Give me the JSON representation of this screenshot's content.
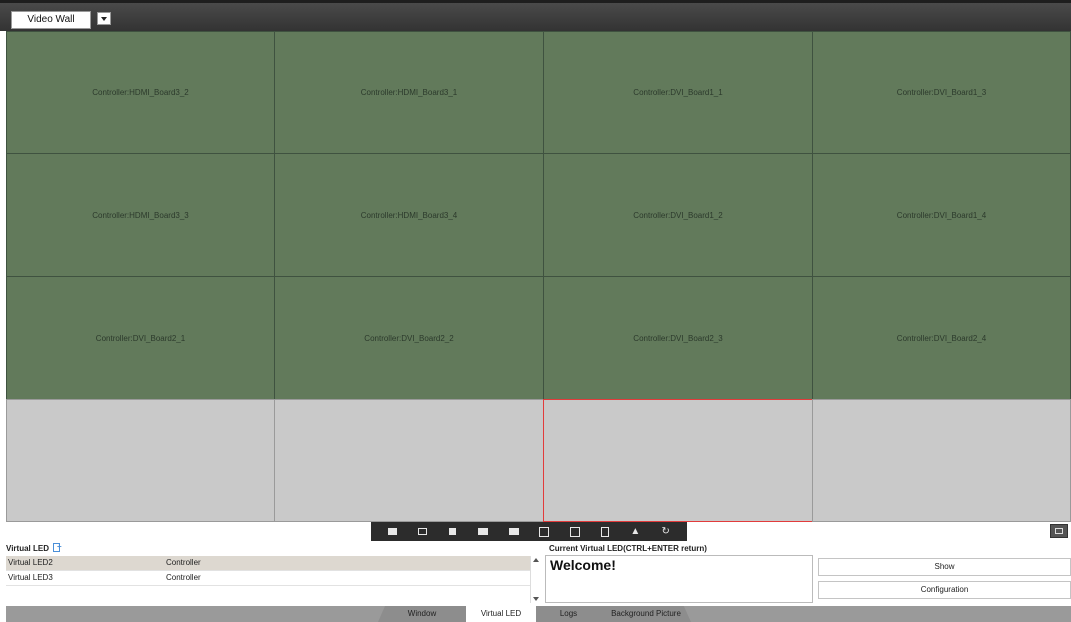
{
  "topbar": {
    "wall_name": "Video Wall"
  },
  "grid": {
    "rows": [
      [
        "Controller:HDMI_Board3_2",
        "Controller:HDMI_Board3_1",
        "Controller:DVI_Board1_1",
        "Controller:DVI_Board1_3"
      ],
      [
        "Controller:HDMI_Board3_3",
        "Controller:HDMI_Board3_4",
        "Controller:DVI_Board1_2",
        "Controller:DVI_Board1_4"
      ],
      [
        "Controller:DVI_Board2_1",
        "Controller:DVI_Board2_2",
        "Controller:DVI_Board2_3",
        "Controller:DVI_Board2_4"
      ],
      [
        "",
        "",
        "",
        ""
      ]
    ],
    "colors": {
      "assigned": "#627a5b",
      "empty": "#c9c9c9",
      "selected_border": "#e23b3b"
    }
  },
  "toolbar": {
    "icons": [
      "screenshot-icon",
      "window-icon",
      "layers-icon",
      "image-icon",
      "picture-icon",
      "split-icon",
      "center-icon",
      "copy-icon",
      "mirror-icon",
      "refresh-icon"
    ]
  },
  "virtual_led": {
    "header": "Virtual LED",
    "rows": [
      {
        "name": "Virtual LED2",
        "type": "Controller"
      },
      {
        "name": "Virtual LED3",
        "type": "Controller"
      }
    ]
  },
  "current_led": {
    "header": "Current Virtual LED(CTRL+ENTER return)",
    "text": "Welcome!",
    "show_label": "Show",
    "configuration_label": "Configuration"
  },
  "tabs": [
    {
      "label": "Window",
      "active": false
    },
    {
      "label": "Virtual LED",
      "active": true
    },
    {
      "label": "Logs",
      "active": false
    },
    {
      "label": "Background Picture",
      "active": false
    }
  ]
}
